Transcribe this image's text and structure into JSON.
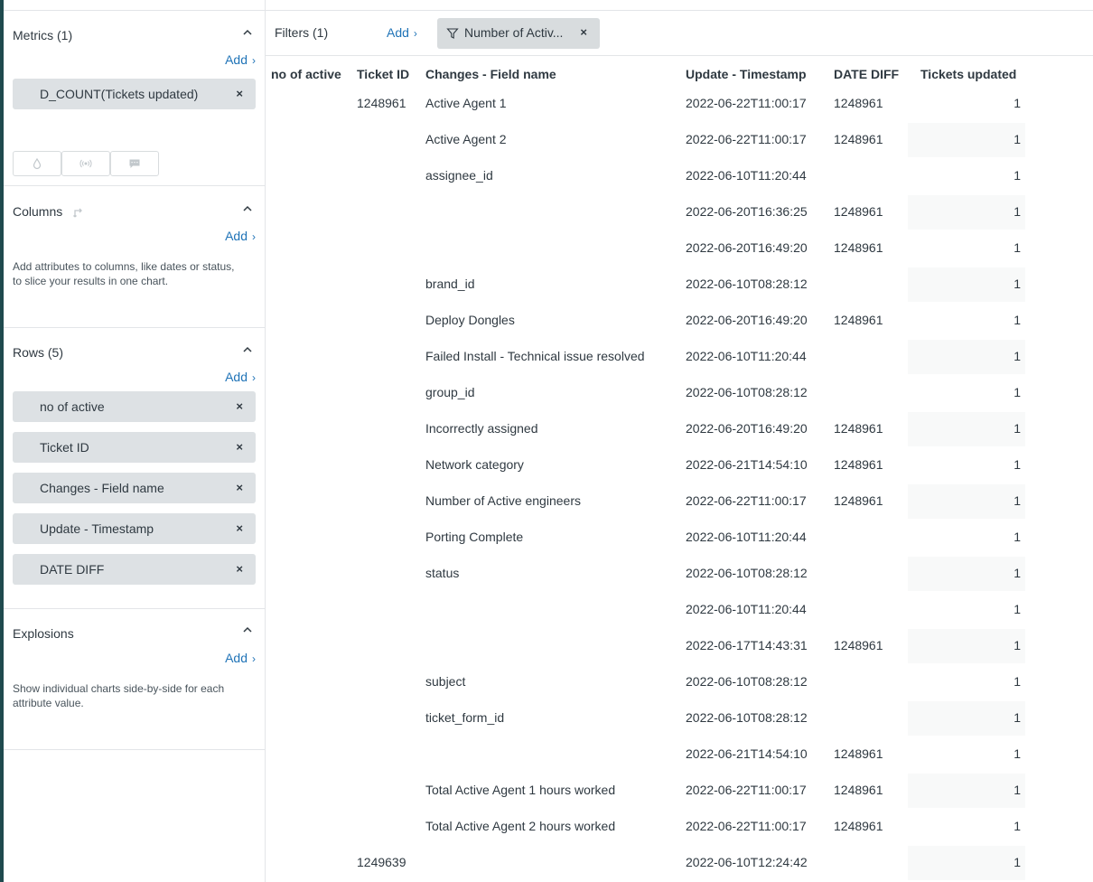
{
  "sidebar": {
    "metrics": {
      "title": "Metrics (1)",
      "add_label": "Add",
      "items": [
        {
          "label": "D_COUNT(Tickets updated)"
        }
      ]
    },
    "columns": {
      "title": "Columns",
      "add_label": "Add",
      "help": "Add attributes to columns, like dates or status, to slice your results in one chart."
    },
    "rows": {
      "title": "Rows (5)",
      "add_label": "Add",
      "items": [
        {
          "label": "no of active"
        },
        {
          "label": "Ticket ID"
        },
        {
          "label": "Changes - Field name"
        },
        {
          "label": "Update - Timestamp"
        },
        {
          "label": "DATE DIFF"
        }
      ]
    },
    "explosions": {
      "title": "Explosions",
      "add_label": "Add",
      "help": "Show individual charts side-by-side for each attribute value."
    },
    "remove_glyph": "×"
  },
  "filters": {
    "title": "Filters (1)",
    "add_label": "Add",
    "chip_label": "Number of Activ...",
    "remove_glyph": "×"
  },
  "table": {
    "headers": {
      "no_of_active": "no of active",
      "ticket_id": "Ticket ID",
      "field_name": "Changes - Field name",
      "timestamp": "Update - Timestamp",
      "date_diff": "DATE DIFF",
      "tickets_updated": "Tickets updated"
    },
    "rows": [
      {
        "ticket_id": "1248961",
        "field": "Active Agent 1",
        "timestamp": "2022-06-22T11:00:17",
        "date_diff": "1248961",
        "value": "1"
      },
      {
        "ticket_id": "",
        "field": "Active Agent 2",
        "timestamp": "2022-06-22T11:00:17",
        "date_diff": "1248961",
        "value": "1"
      },
      {
        "ticket_id": "",
        "field": "assignee_id",
        "timestamp": "2022-06-10T11:20:44",
        "date_diff": "",
        "value": "1"
      },
      {
        "ticket_id": "",
        "field": "",
        "timestamp": "2022-06-20T16:36:25",
        "date_diff": "1248961",
        "value": "1"
      },
      {
        "ticket_id": "",
        "field": "",
        "timestamp": "2022-06-20T16:49:20",
        "date_diff": "1248961",
        "value": "1"
      },
      {
        "ticket_id": "",
        "field": "brand_id",
        "timestamp": "2022-06-10T08:28:12",
        "date_diff": "",
        "value": "1"
      },
      {
        "ticket_id": "",
        "field": "Deploy Dongles",
        "timestamp": "2022-06-20T16:49:20",
        "date_diff": "1248961",
        "value": "1"
      },
      {
        "ticket_id": "",
        "field": "Failed Install - Technical issue resolved",
        "timestamp": "2022-06-10T11:20:44",
        "date_diff": "",
        "value": "1"
      },
      {
        "ticket_id": "",
        "field": "group_id",
        "timestamp": "2022-06-10T08:28:12",
        "date_diff": "",
        "value": "1"
      },
      {
        "ticket_id": "",
        "field": "Incorrectly assigned",
        "timestamp": "2022-06-20T16:49:20",
        "date_diff": "1248961",
        "value": "1"
      },
      {
        "ticket_id": "",
        "field": "Network category",
        "timestamp": "2022-06-21T14:54:10",
        "date_diff": "1248961",
        "value": "1"
      },
      {
        "ticket_id": "",
        "field": "Number of Active engineers",
        "timestamp": "2022-06-22T11:00:17",
        "date_diff": "1248961",
        "value": "1"
      },
      {
        "ticket_id": "",
        "field": "Porting Complete",
        "timestamp": "2022-06-10T11:20:44",
        "date_diff": "",
        "value": "1"
      },
      {
        "ticket_id": "",
        "field": "status",
        "timestamp": "2022-06-10T08:28:12",
        "date_diff": "",
        "value": "1"
      },
      {
        "ticket_id": "",
        "field": "",
        "timestamp": "2022-06-10T11:20:44",
        "date_diff": "",
        "value": "1"
      },
      {
        "ticket_id": "",
        "field": "",
        "timestamp": "2022-06-17T14:43:31",
        "date_diff": "1248961",
        "value": "1"
      },
      {
        "ticket_id": "",
        "field": "subject",
        "timestamp": "2022-06-10T08:28:12",
        "date_diff": "",
        "value": "1"
      },
      {
        "ticket_id": "",
        "field": "ticket_form_id",
        "timestamp": "2022-06-10T08:28:12",
        "date_diff": "",
        "value": "1"
      },
      {
        "ticket_id": "",
        "field": "",
        "timestamp": "2022-06-21T14:54:10",
        "date_diff": "1248961",
        "value": "1"
      },
      {
        "ticket_id": "",
        "field": "Total Active Agent 1 hours worked",
        "timestamp": "2022-06-22T11:00:17",
        "date_diff": "1248961",
        "value": "1"
      },
      {
        "ticket_id": "",
        "field": "Total Active Agent 2 hours worked",
        "timestamp": "2022-06-22T11:00:17",
        "date_diff": "1248961",
        "value": "1"
      },
      {
        "ticket_id": "1249639",
        "field": "",
        "timestamp": "2022-06-10T12:24:42",
        "date_diff": "",
        "value": "1"
      }
    ]
  },
  "colors": {
    "accent": "#1f73b7",
    "pill_bg": "#dde1e4",
    "left_strip": "#1f4a4e"
  }
}
